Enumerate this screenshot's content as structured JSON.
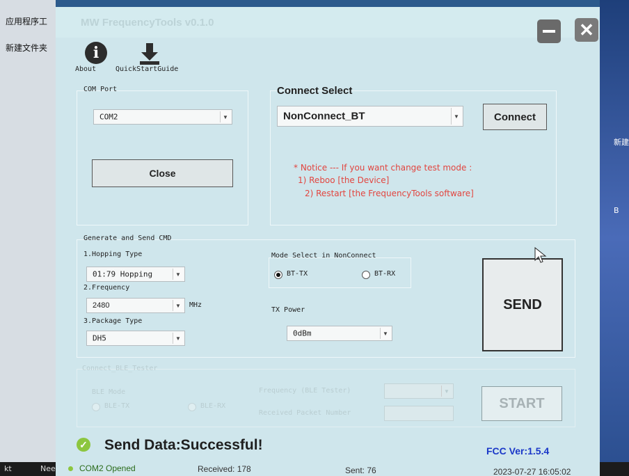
{
  "desktop": {
    "left_items": [
      "应用程序工",
      "新建文件夹"
    ],
    "right_items": [
      "新建",
      "B"
    ],
    "taskbar_items": [
      "kt",
      "Neeo"
    ]
  },
  "window": {
    "title": "MW FrequencyTools v0.1.0",
    "toolbar": {
      "about_label": "About",
      "guide_label": "QuickStartGuide"
    }
  },
  "com_port": {
    "label": "COM Port",
    "selected": "COM2",
    "close_label": "Close"
  },
  "connect_select": {
    "label": "Connect Select",
    "selected": "NonConnect_BT",
    "connect_label": "Connect",
    "notice_line1": "* Notice --- If you want change test mode :",
    "notice_line2": "1) Reboo [the Device]",
    "notice_line3": "2) Restart [the FrequencyTools software]"
  },
  "generate": {
    "label": "Generate and Send CMD",
    "hopping_label": "1.Hopping Type",
    "hopping_value": "01:79 Hopping",
    "frequency_label": "2.Frequency",
    "frequency_value": "2480",
    "frequency_unit": "MHz",
    "package_label": "3.Package Type",
    "package_value": "DH5",
    "mode_label": "Mode Select in NonConnect",
    "mode_tx": "BT-TX",
    "mode_rx": "BT-RX",
    "tx_power_label": "TX Power",
    "tx_power_value": "0dBm",
    "send_label": "SEND"
  },
  "ble": {
    "label": "Connect_BLE_Tester",
    "mode_label": "BLE Mode",
    "tx": "BLE-TX",
    "rx": "BLE-RX",
    "frequency_label": "Frequency (BLE Tester)",
    "received_label": "Received Packet Number",
    "start_label": "START"
  },
  "result": {
    "message": "Send Data:Successful!",
    "version": "FCC Ver:1.5.4"
  },
  "statusbar": {
    "port_status": "COM2 Opened",
    "received": "Received: 178",
    "sent": "Sent: 76",
    "datetime": "2023-07-27 16:05:02"
  },
  "colors": {
    "window_bg": "#cfe6ec",
    "notice_red": "#e2453f",
    "version_blue": "#1a37c8",
    "ok_green": "#8cc63f"
  }
}
